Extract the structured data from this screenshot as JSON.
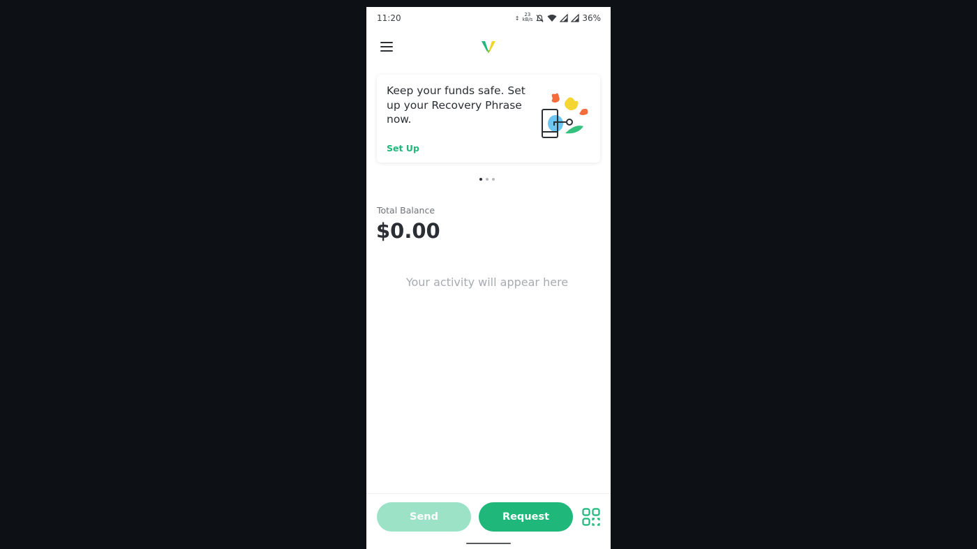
{
  "status_bar": {
    "time": "11:20",
    "net_speed_value": "23",
    "net_speed_unit": "kB/s",
    "battery": "36%"
  },
  "header": {
    "logo_icon": "app-logo-icon",
    "menu_icon": "hamburger-menu-icon"
  },
  "promo_card": {
    "message": "Keep your funds safe. Set up your Recovery Phrase now.",
    "action": "Set Up",
    "illustration": "recovery-phrase-illustration"
  },
  "carousel": {
    "pages": 3,
    "active": 0
  },
  "balance": {
    "label": "Total Balance",
    "value": "$0.00"
  },
  "activity": {
    "empty_text": "Your activity will appear here"
  },
  "actions": {
    "send_label": "Send",
    "request_label": "Request",
    "scan_icon": "qr-scan-icon"
  },
  "colors": {
    "accent": "#1fb87a",
    "accent_disabled": "#9be2c6",
    "text": "#2b2e33"
  }
}
